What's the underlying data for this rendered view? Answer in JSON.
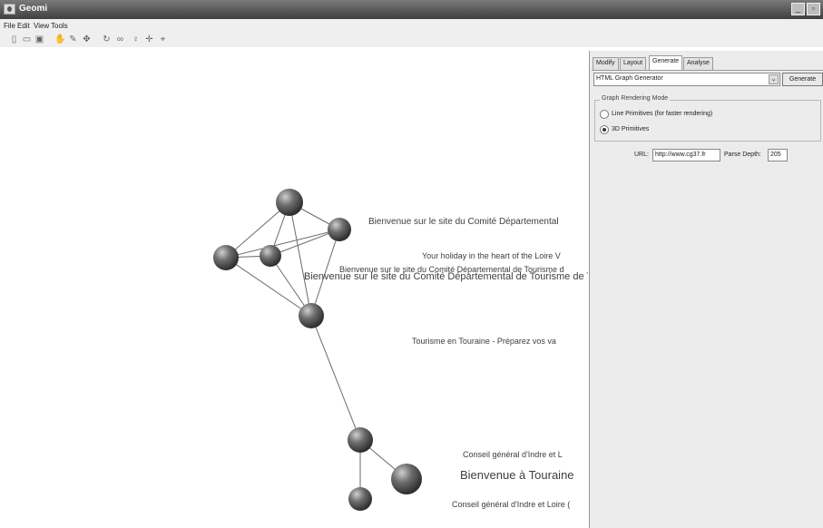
{
  "window": {
    "title": "Geomi"
  },
  "menu": [
    "File",
    "Edit",
    "View",
    "Tools"
  ],
  "toolbar_icons": [
    "new-icon",
    "open-icon",
    "save-icon",
    "hand-icon",
    "pen-icon",
    "move-icon",
    "rotate-icon",
    "zoom-icon",
    "bulb-icon",
    "pan-icon",
    "link-icon"
  ],
  "panel": {
    "tabs": [
      "Modify",
      "Layout",
      "Generate",
      "Analyse"
    ],
    "active_tab": "Generate",
    "generator_select": "HTML Graph Generator",
    "generate_label": "Generate",
    "group_title": "Graph Rendering Mode",
    "radio_options": [
      "Line Primitives (for faster rendering)",
      "3D Primitives"
    ],
    "radio_selected": 1,
    "url_label": "URL:",
    "url_value": "http://www.cg37.fr",
    "depth_label": "Parse Depth:",
    "depth_value": "205"
  },
  "graph": {
    "labels": [
      "Bienvenue sur le site du Comité Départemental",
      "Your holiday in the heart of the Loire V",
      "Bienvenue sur le site du Comité Départemental de Tourisme d",
      "Bienvenue sur le site du Comité Départemental de Tourisme de T",
      "Tourisme en Touraine - Préparez vos va",
      "Conseil général d'Indre et L",
      "Bienvenue à Touraine",
      "Conseil général d'Indre et Loire ("
    ]
  }
}
